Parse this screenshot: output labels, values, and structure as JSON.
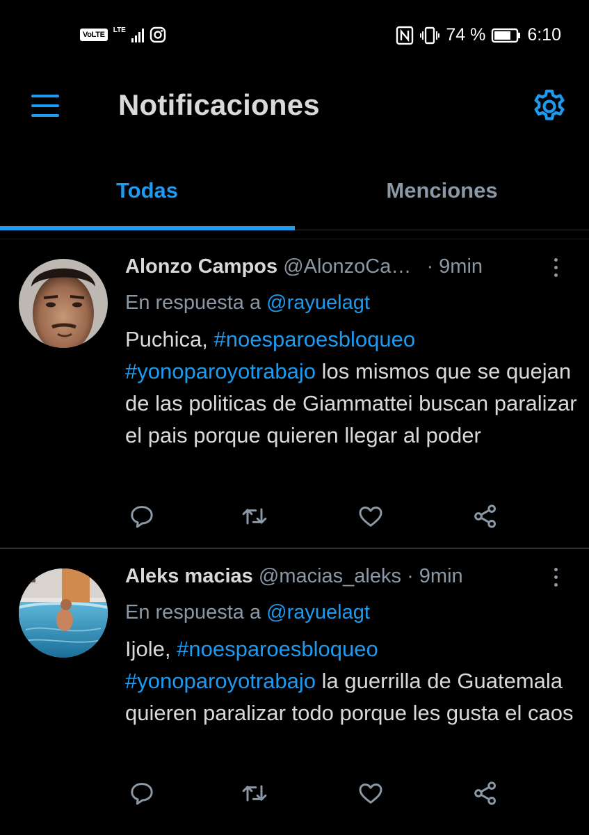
{
  "status_bar": {
    "volte": "VoLTE",
    "lte": "LTE",
    "battery_percent": "74 %",
    "time": "6:10",
    "icons": [
      "signal-icon",
      "instagram-icon",
      "nfc-icon",
      "vibrate-icon",
      "battery-icon"
    ]
  },
  "header": {
    "title": "Notificaciones",
    "menu_icon": "hamburger-menu-icon",
    "settings_icon": "gear-icon"
  },
  "tabs": [
    {
      "label": "Todas",
      "active": true
    },
    {
      "label": "Menciones",
      "active": false
    }
  ],
  "tweets": [
    {
      "name": "Alonzo Campos",
      "handle": "@AlonzoCa…",
      "separator": "·",
      "time": "9min",
      "reply_prefix": "En respuesta a",
      "reply_to": "@rayuelagt",
      "text": {
        "lead": "Puchica, ",
        "tag1": "#noesparoesbloqueo",
        "tag2": "#yonoparoyotrabajo",
        "rest": " los mismos que se quejan de las politicas de Giammattei buscan paralizar el pais porque quieren llegar al poder"
      }
    },
    {
      "name": "Aleks macias",
      "handle": "@macias_aleks",
      "separator": "·",
      "time": "9min",
      "reply_prefix": "En respuesta a",
      "reply_to": "@rayuelagt",
      "text": {
        "lead": "Ijole, ",
        "tag1": "#noesparoesbloqueo",
        "tag2": "#yonoparoyotrabajo",
        "rest": " la guerrilla de Guatemala quieren paralizar todo porque les gusta el caos"
      }
    }
  ],
  "colors": {
    "background": "#000000",
    "accent": "#1d9bf0",
    "primary_text": "#d9d9d9",
    "secondary_text": "#8b98a5"
  }
}
